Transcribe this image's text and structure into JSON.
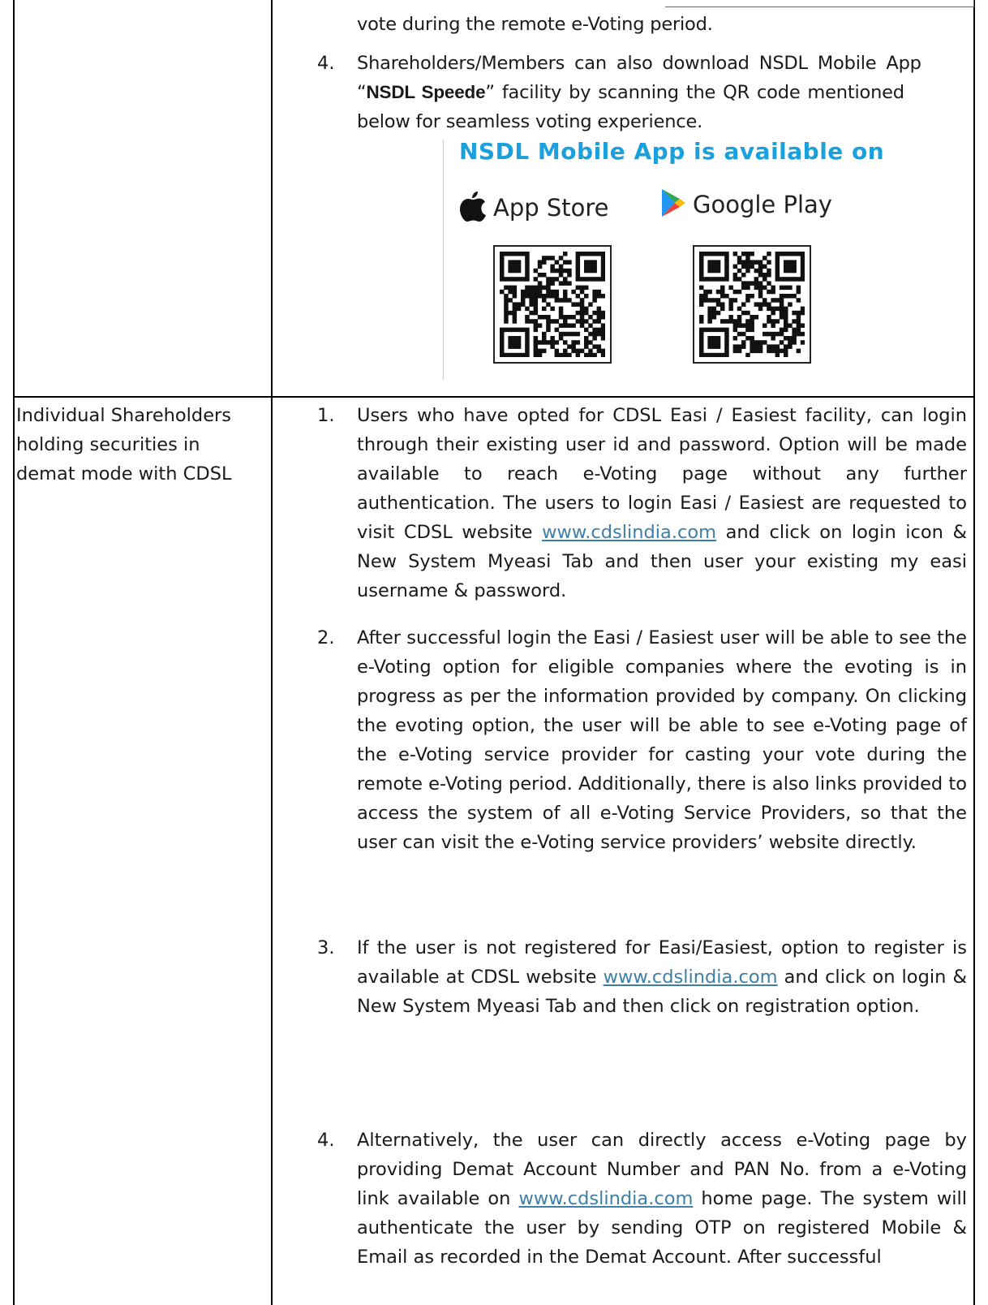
{
  "nsdl": {
    "trailing_line": "vote during the remote e-Voting period.",
    "item4_number": "4.",
    "item4_line1": "Shareholders/Members can also download NSDL Mobile App",
    "item4_quote_open": "“",
    "item4_app_name": "NSDL Speede",
    "item4_quote_rest": "” facility by scanning the QR code mentioned",
    "item4_line3": "below for seamless voting experience.",
    "promo_title": "NSDL Mobile App is available on",
    "app_store_label": "App Store",
    "google_play_label": "Google Play"
  },
  "cdsl": {
    "left_label_lines": [
      "Individual Shareholders",
      "holding securities in",
      "demat mode with CDSL"
    ],
    "items": [
      {
        "number": "1.",
        "before_link": "Users who have opted for CDSL Easi / Easiest facility, can login through their existing user id and password. Option will be made available to reach e-Voting page without any further authentication. The users to login Easi / Easiest are requested to visit CDSL website ",
        "link": "www.cdslindia.com",
        "after_link": " and click on login icon & New System Myeasi Tab and then user your existing my easi username & password."
      },
      {
        "number": "2.",
        "text": "After successful login the Easi / Easiest user will be able to see the e-Voting option for eligible companies where the evoting is in progress as per the information provided by company. On clicking the evoting option, the user will be able to see e-Voting page of the e-Voting service provider for casting your vote during the remote e-Voting period. Additionally, there is also links provided to access the system of all e-Voting Service Providers, so that the user can visit the e-Voting service providers’ website directly."
      },
      {
        "number": "3.",
        "before_link": "If the user is not registered for Easi/Easiest, option to register is available at CDSL website ",
        "link": "www.cdslindia.com",
        "after_link": " and click on login & New System Myeasi Tab and then click on registration option."
      },
      {
        "number": "4.",
        "before_link": "Alternatively, the user can directly access e-Voting page by providing Demat Account Number and PAN No. from a e-Voting link available on ",
        "link": "www.cdslindia.com",
        "after_link": " home page. The system will authenticate the user by sending OTP on registered Mobile & Email as recorded in the Demat Account. After successful"
      }
    ]
  },
  "colors": {
    "link": "#3d7fa6",
    "promo_title": "#1aa0dc",
    "border": "#000000"
  },
  "icons": [
    "apple-icon",
    "google-play-icon",
    "qr-code-icon"
  ]
}
